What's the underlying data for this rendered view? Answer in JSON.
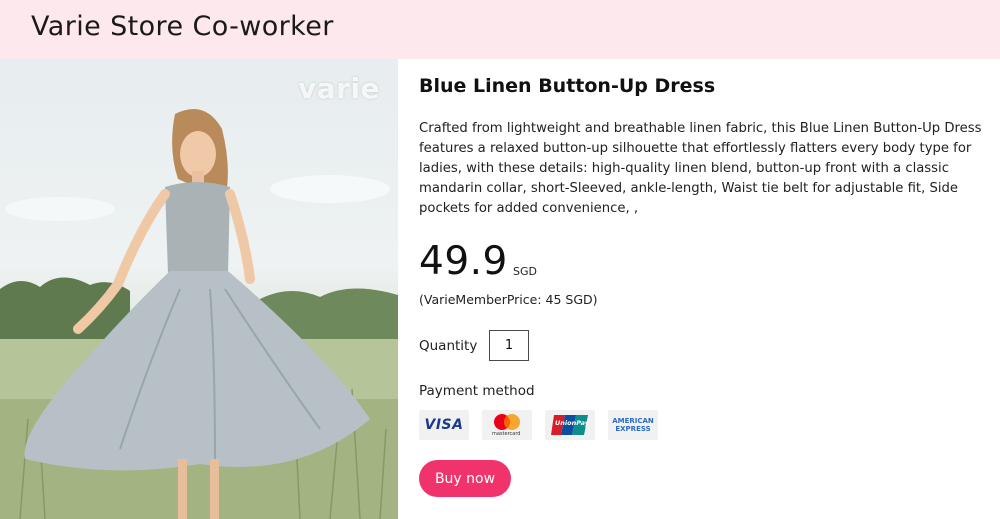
{
  "header": {
    "title": "Varie Store Co-worker"
  },
  "image": {
    "watermark": "varie",
    "alt": "Woman twirling in a light blue linen dress in a meadow"
  },
  "product": {
    "title": "Blue Linen Button-Up Dress",
    "description": "Crafted from lightweight and breathable linen fabric, this Blue Linen Button-Up Dress features a relaxed button-up silhouette that effortlessly flatters every body type for ladies, with these details: high-quality linen blend, button-up front with a classic mandarin collar, short-Sleeved, ankle-length, Waist tie belt for adjustable fit, Side pockets for added convenience, ,",
    "price": "49.9",
    "currency": "SGD",
    "member_price": "(VarieMemberPrice: 45 SGD)"
  },
  "quantity": {
    "label": "Quantity",
    "value": "1"
  },
  "payment": {
    "label": "Payment method",
    "methods": [
      {
        "name": "VISA",
        "icon": "visa-icon"
      },
      {
        "name": "mastercard",
        "icon": "mastercard-icon"
      },
      {
        "name": "UnionPay",
        "icon": "unionpay-icon"
      },
      {
        "name": "AMERICAN EXPRESS",
        "icon": "amex-icon"
      }
    ]
  },
  "actions": {
    "buy_label": "Buy now",
    "buy_color": "#f0336a"
  },
  "colors": {
    "header_bg": "#fde8ee",
    "accent": "#f0336a"
  }
}
